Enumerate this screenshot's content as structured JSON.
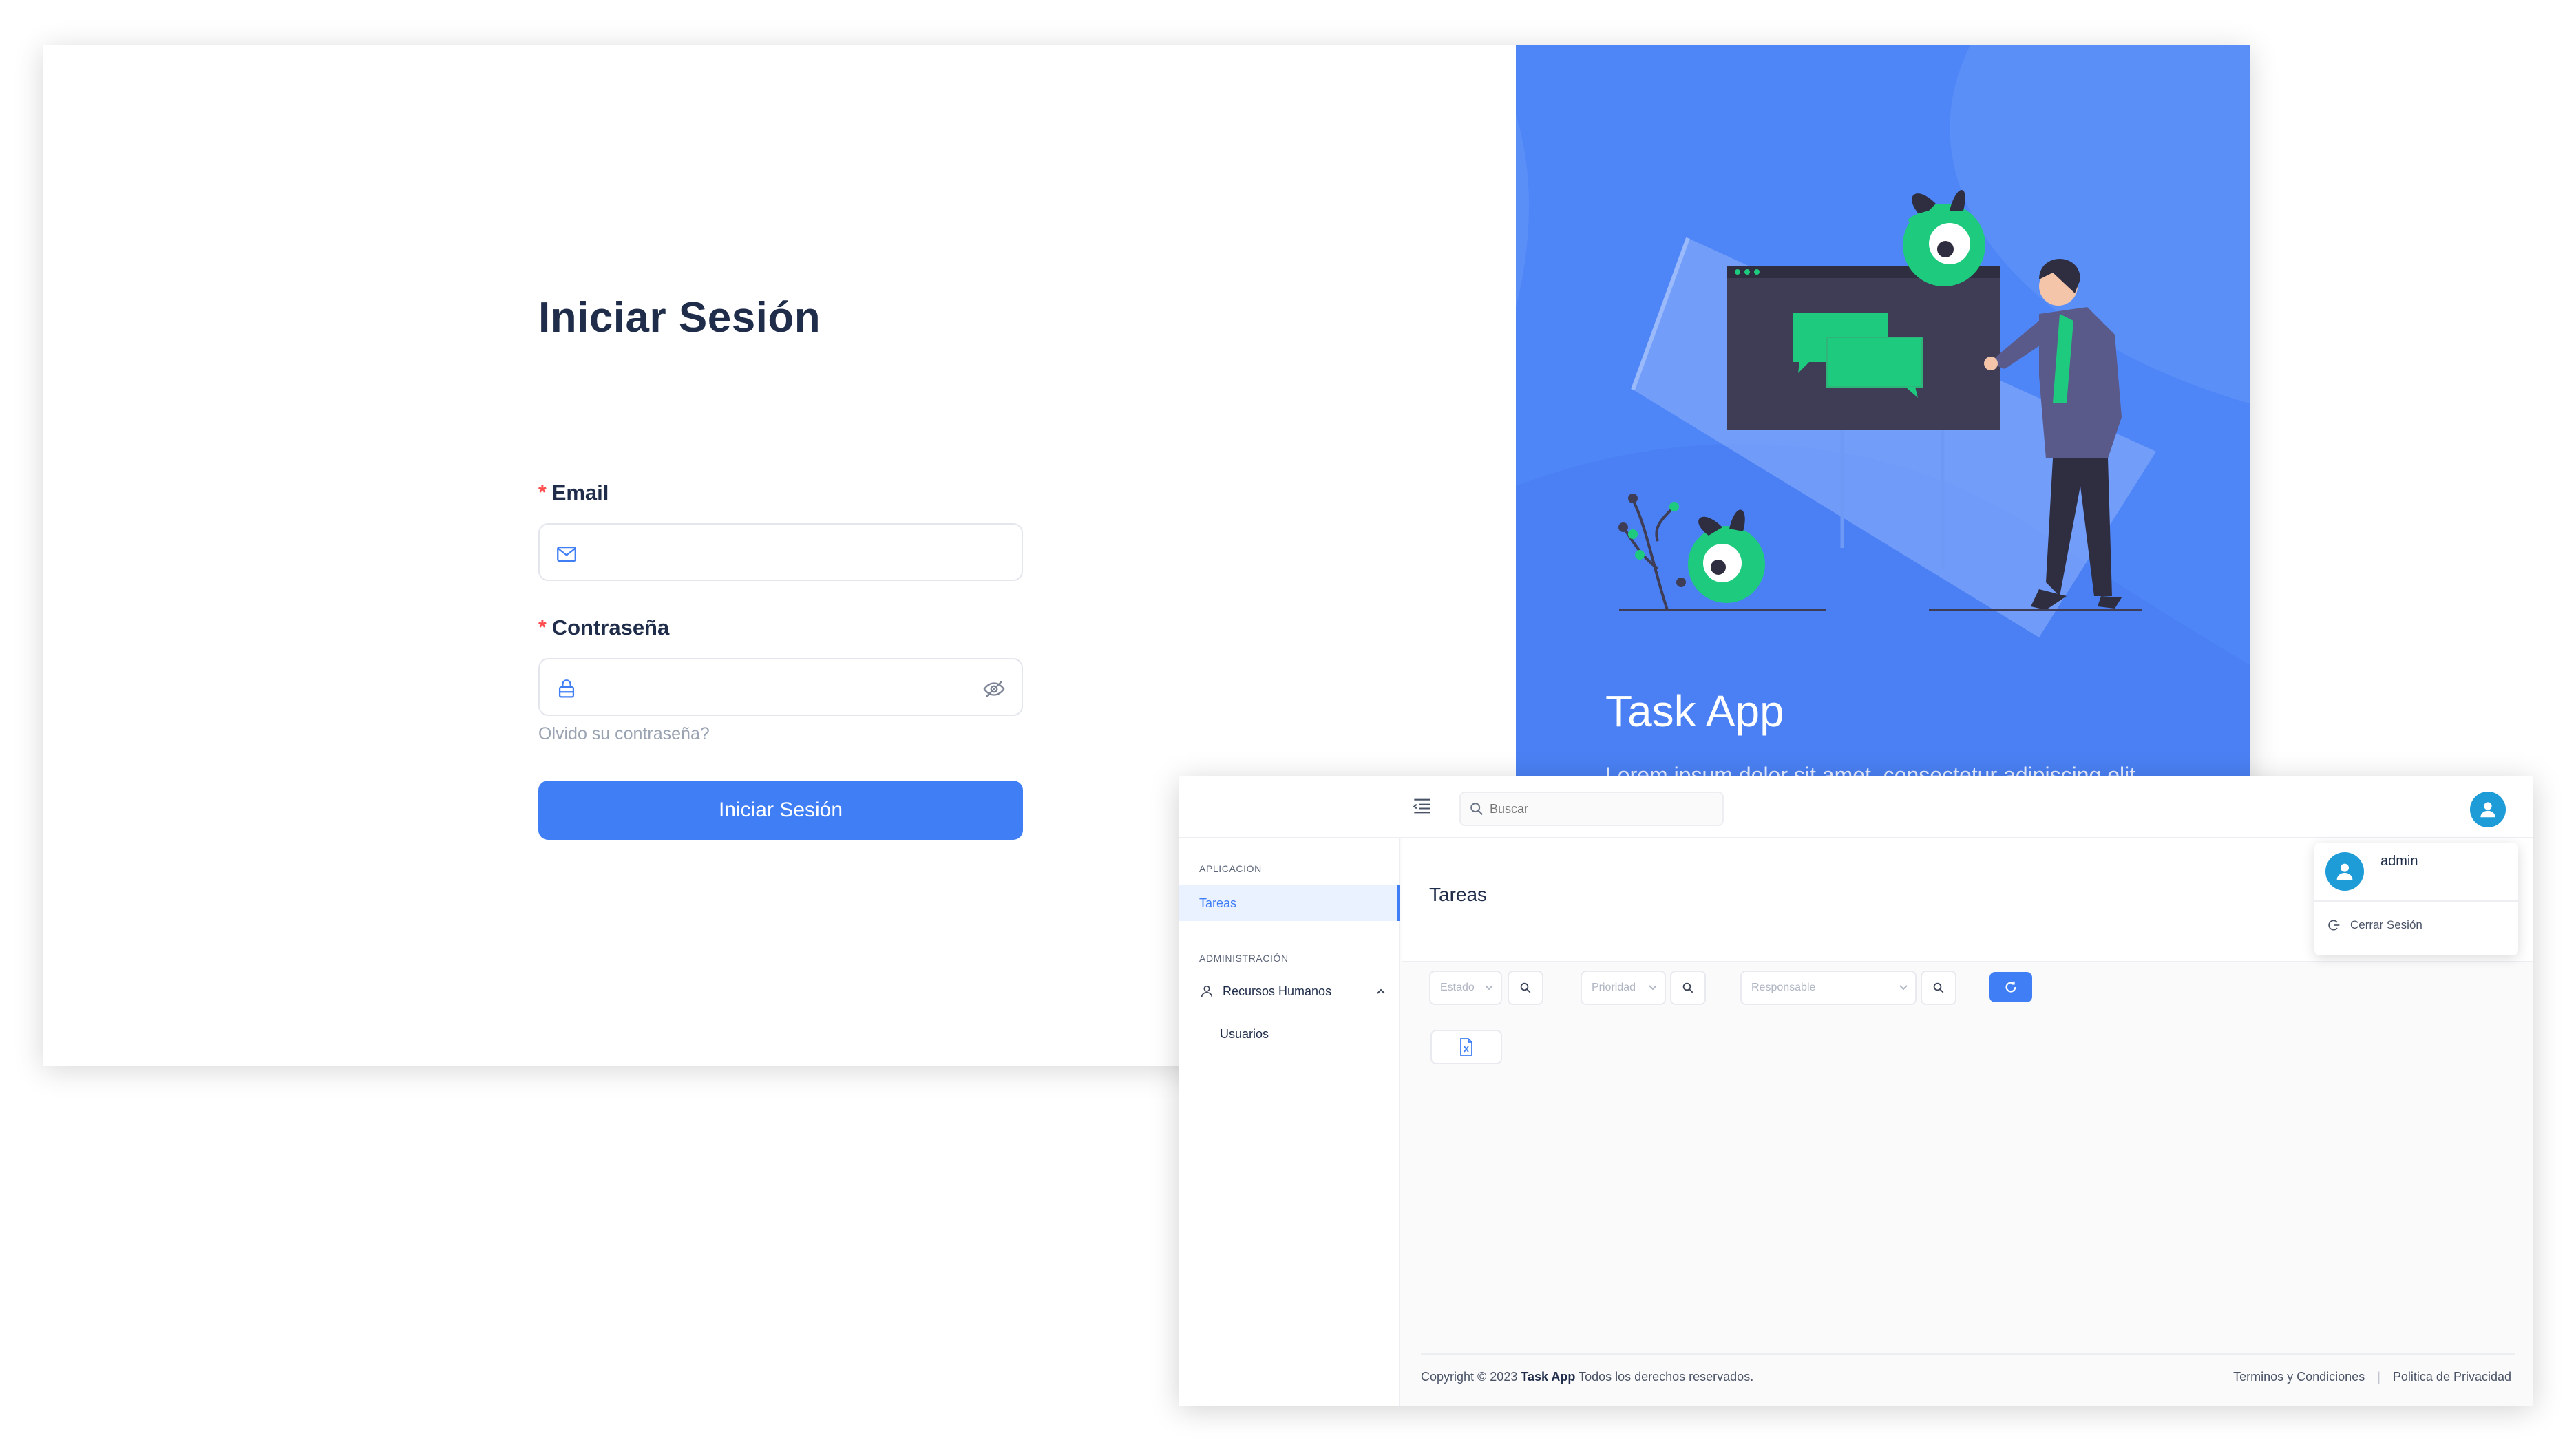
{
  "login": {
    "title": "Iniciar Sesión",
    "required_mark": "*",
    "email_label": "Email",
    "password_label": "Contraseña",
    "forgot_link": "Olvido su contraseña?",
    "submit_label": "Iniciar Sesión"
  },
  "hero": {
    "title": "Task App",
    "subtitle": "Lorem ipsum dolor sit amet, consectetur adipiscing elit",
    "background": "#4f86f7",
    "accent_green": "#1ecb7e"
  },
  "admin": {
    "search_placeholder": "Buscar",
    "sidebar": {
      "section_app": "APLICACION",
      "item_tasks": "Tareas",
      "section_admin": "ADMINISTRACIÓN",
      "item_hr": "Recursos Humanos",
      "item_users": "Usuarios"
    },
    "page_title": "Tareas",
    "filters": {
      "estado": "Estado",
      "prioridad": "Prioridad",
      "responsable": "Responsable"
    },
    "user_menu": {
      "name": "admin",
      "logout": "Cerrar Sesión"
    },
    "footer": {
      "copyright_prefix": "Copyright © 2023",
      "brand": "Task App",
      "copyright_suffix": "Todos los derechos reservados.",
      "terms": "Terminos y Condiciones",
      "separator": "|",
      "privacy": "Politica de Privacidad"
    },
    "colors": {
      "primary": "#3f7ef5",
      "avatar": "#1e9cd7"
    }
  }
}
